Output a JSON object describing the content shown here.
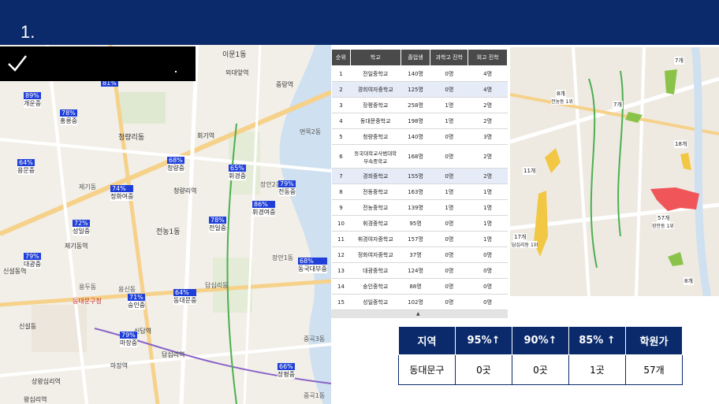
{
  "header": {
    "title": "1."
  },
  "colors": {
    "header_bg": "#0a2a6b",
    "flag": "#1f3fd8",
    "highlight_row": "#e6ebf8"
  },
  "banner": {
    "icon": "check-icon"
  },
  "map_left": {
    "place_labels": [
      "이문1동",
      "외대앞역",
      "회기역",
      "청량리동",
      "중랑역",
      "면목2동",
      "제기동",
      "전농1동",
      "제기동역",
      "용두동",
      "용신동",
      "청량리역",
      "신설동역",
      "동대문구청",
      "답십리역",
      "마장역",
      "신답역",
      "답십리동",
      "장안1동",
      "장안2동",
      "상왕십리역",
      "왕십리역",
      "중곡3동",
      "중곡1동",
      "신설동"
    ],
    "pins": [
      {
        "pct": "89%",
        "school": "개운중"
      },
      {
        "pct": "81%",
        "school": ""
      },
      {
        "pct": "78%",
        "school": "홍릉중"
      },
      {
        "pct": "64%",
        "school": "용문중"
      },
      {
        "pct": "68%",
        "school": "청량중"
      },
      {
        "pct": "65%",
        "school": "휘경중"
      },
      {
        "pct": "74%",
        "school": "정화여중"
      },
      {
        "pct": "79%",
        "school": "전동중"
      },
      {
        "pct": "86%",
        "school": "휘경여중"
      },
      {
        "pct": "72%",
        "school": "성일중"
      },
      {
        "pct": "78%",
        "school": "전일중"
      },
      {
        "pct": "79%",
        "school": "대광중"
      },
      {
        "pct": "68%",
        "school": "동국대부중"
      },
      {
        "pct": "71%",
        "school": "숭인중"
      },
      {
        "pct": "64%",
        "school": "동대문중"
      },
      {
        "pct": "79%",
        "school": "마장중"
      },
      {
        "pct": "66%",
        "school": "장평중"
      }
    ]
  },
  "map_right": {
    "counts": [
      "7개",
      "8개",
      "7개",
      "18개",
      "11개",
      "57개",
      "17개",
      "8개"
    ],
    "sub_labels": [
      "장안동 1위",
      "전농동 1위",
      "답십리동 1위"
    ]
  },
  "rank_table": {
    "headers": [
      "순위",
      "학교",
      "졸업생",
      "과학고 진학",
      "외고 진학"
    ],
    "rows": [
      {
        "rank": "1",
        "school": "전일중학교",
        "grads": "140명",
        "sci": "0명",
        "foreign": "4명",
        "hl": false
      },
      {
        "rank": "2",
        "school": "경희여자중학교",
        "grads": "125명",
        "sci": "0명",
        "foreign": "4명",
        "hl": true
      },
      {
        "rank": "3",
        "school": "장평중학교",
        "grads": "258명",
        "sci": "1명",
        "foreign": "2명",
        "hl": false
      },
      {
        "rank": "4",
        "school": "동대문중학교",
        "grads": "198명",
        "sci": "1명",
        "foreign": "2명",
        "hl": false
      },
      {
        "rank": "5",
        "school": "청량중학교",
        "grads": "140명",
        "sci": "0명",
        "foreign": "3명",
        "hl": false
      },
      {
        "rank": "6",
        "school": "동국대학교사범대학부속중학교",
        "grads": "168명",
        "sci": "0명",
        "foreign": "2명",
        "hl": false
      },
      {
        "rank": "7",
        "school": "경희중학교",
        "grads": "155명",
        "sci": "0명",
        "foreign": "2명",
        "hl": true
      },
      {
        "rank": "8",
        "school": "전동중학교",
        "grads": "163명",
        "sci": "1명",
        "foreign": "1명",
        "hl": false
      },
      {
        "rank": "9",
        "school": "전농중학교",
        "grads": "139명",
        "sci": "1명",
        "foreign": "1명",
        "hl": false
      },
      {
        "rank": "10",
        "school": "휘경중학교",
        "grads": "95명",
        "sci": "0명",
        "foreign": "1명",
        "hl": false
      },
      {
        "rank": "11",
        "school": "휘경여자중학교",
        "grads": "157명",
        "sci": "0명",
        "foreign": "1명",
        "hl": false
      },
      {
        "rank": "12",
        "school": "정화여자중학교",
        "grads": "37명",
        "sci": "0명",
        "foreign": "0명",
        "hl": false
      },
      {
        "rank": "13",
        "school": "대광중학교",
        "grads": "124명",
        "sci": "0명",
        "foreign": "0명",
        "hl": false
      },
      {
        "rank": "14",
        "school": "숭인중학교",
        "grads": "88명",
        "sci": "0명",
        "foreign": "0명",
        "hl": false
      },
      {
        "rank": "15",
        "school": "성일중학교",
        "grads": "102명",
        "sci": "0명",
        "foreign": "0명",
        "hl": false
      }
    ],
    "scroll_glyph": "▲"
  },
  "summary": {
    "headers": [
      "지역",
      "95%↑",
      "90%↑",
      "85% ↑",
      "학원가"
    ],
    "values": [
      "동대문구",
      "0곳",
      "0곳",
      "1곳",
      "57개"
    ]
  }
}
